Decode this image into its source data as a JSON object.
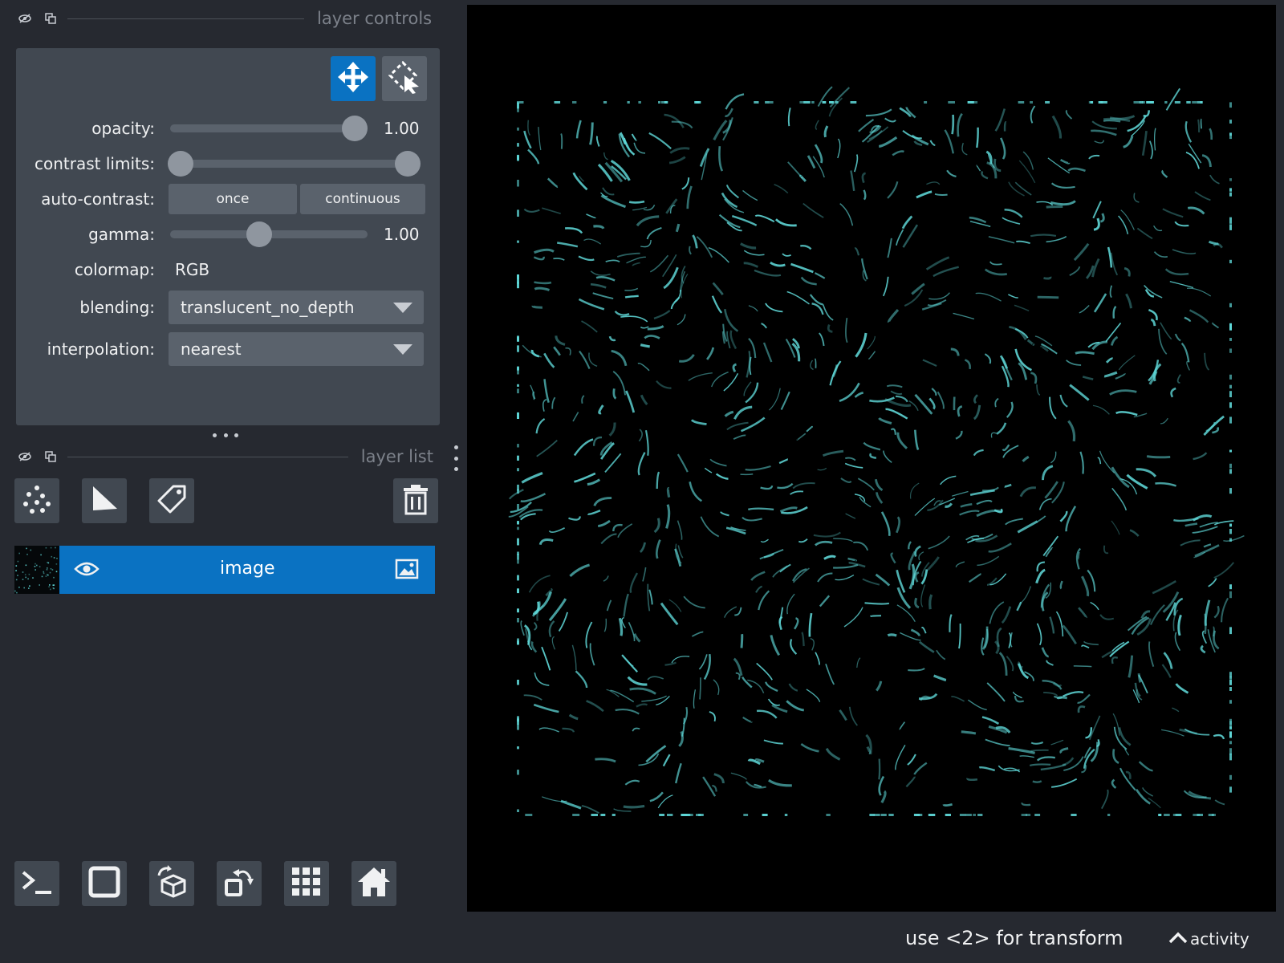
{
  "layer_controls": {
    "title": "layer controls",
    "opacity": {
      "label": "opacity:",
      "value_text": "1.00",
      "value": 1.0
    },
    "contrast_limits": {
      "label": "contrast limits:",
      "low": 0.0,
      "high": 1.0
    },
    "auto_contrast": {
      "label": "auto-contrast:",
      "once_label": "once",
      "continuous_label": "continuous"
    },
    "gamma": {
      "label": "gamma:",
      "value_text": "1.00",
      "value": 1.0
    },
    "colormap": {
      "label": "colormap:",
      "value": "RGB"
    },
    "blending": {
      "label": "blending:",
      "value": "translucent_no_depth"
    },
    "interpolation": {
      "label": "interpolation:",
      "value": "nearest"
    },
    "modes": [
      {
        "icon": "move-icon",
        "active": true
      },
      {
        "icon": "transform-icon",
        "active": false
      }
    ]
  },
  "layer_list": {
    "title": "layer list",
    "tools": [
      "points-icon",
      "shapes-icon",
      "labels-icon",
      "delete-icon"
    ],
    "layers": [
      {
        "name": "image",
        "visible": true,
        "type_icon": "image-icon",
        "selected": true
      }
    ]
  },
  "bottom_toolbar": [
    "console-icon",
    "ndisplay-icon",
    "roll-axes-icon",
    "transpose-icon",
    "grid-icon",
    "home-icon"
  ],
  "status": {
    "message": "use <2> for transform",
    "activity_label": "activity"
  },
  "colors": {
    "accent": "#0a72c2",
    "background": "#262930",
    "panel": "#414851",
    "field": "#5a626c",
    "streak": "#5fd8d8"
  }
}
